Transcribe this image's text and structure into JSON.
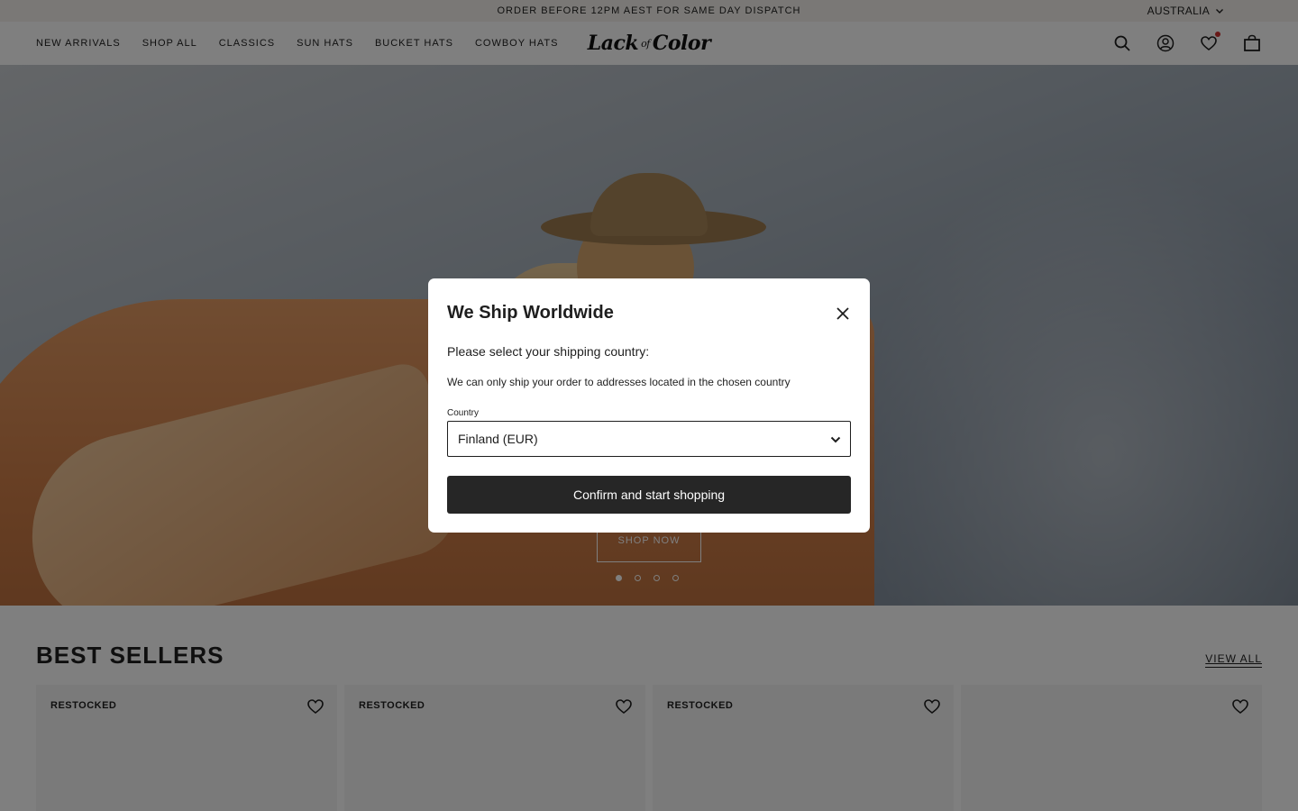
{
  "announcement": {
    "text": "ORDER BEFORE 12PM AEST FOR SAME DAY DISPATCH"
  },
  "region": {
    "label": "AUSTRALIA"
  },
  "nav": {
    "items": [
      {
        "label": "NEW ARRIVALS"
      },
      {
        "label": "SHOP ALL"
      },
      {
        "label": "CLASSICS"
      },
      {
        "label": "SUN HATS"
      },
      {
        "label": "BUCKET HATS"
      },
      {
        "label": "COWBOY HATS"
      }
    ]
  },
  "logo": {
    "main": "Lack",
    "joiner": "of",
    "end": "Color"
  },
  "header_icons": [
    "search-icon",
    "account-icon",
    "wishlist-icon",
    "bag-icon"
  ],
  "hero": {
    "cta": "SHOP NOW",
    "slide_count": 4,
    "active_slide": 1
  },
  "best_sellers": {
    "title": "BEST SELLERS",
    "view_all": "VIEW ALL",
    "cards": [
      {
        "badge": "RESTOCKED"
      },
      {
        "badge": "RESTOCKED"
      },
      {
        "badge": "RESTOCKED"
      },
      {
        "badge": ""
      }
    ]
  },
  "modal": {
    "title": "We Ship Worldwide",
    "subtitle": "Please select your shipping country:",
    "note": "We can only ship your order to addresses located in the chosen country",
    "country_label": "Country",
    "country_value": "Finland (EUR)",
    "confirm_label": "Confirm and start shopping"
  },
  "colors": {
    "overlay": "#000000",
    "button": "#262626",
    "wishlist_dot": "#d0302f"
  }
}
